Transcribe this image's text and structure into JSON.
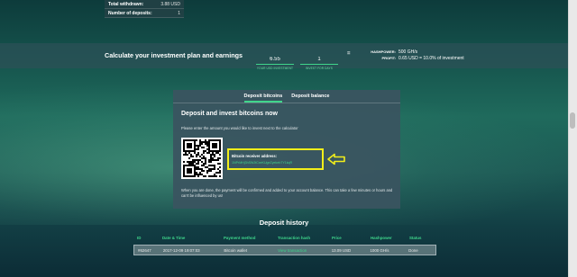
{
  "colors": {
    "accent": "#3ed58b",
    "highlight_border": "#f2ee1a",
    "panel": "#3a5460"
  },
  "stats": [
    {
      "label": "Total withdrawn:",
      "value": "3.88 USD"
    },
    {
      "label": "Number of deposits:",
      "value": "1"
    }
  ],
  "calculator": {
    "title": "Calculate your investment plan and earnings",
    "investment": {
      "value": "6.55",
      "caption": "YOUR USD INVESTMENT"
    },
    "days": {
      "value": "1",
      "caption": "INVEST FOR DAYS"
    },
    "equals": "=",
    "hashpower": {
      "label": "HASHPOWER:",
      "value": "500 GH/s"
    },
    "profit": {
      "label": "PROFIT:",
      "value": "0.65 USD = 10.0% of investment"
    }
  },
  "deposit_card": {
    "tabs": [
      "Deposit bitcoins",
      "Deposit balance"
    ],
    "active_tab": "Deposit bitcoins",
    "title": "Deposit and invest bitcoins now",
    "instruction": "Please enter the amount you would like to invest next to the calculator",
    "receiver_label": "Bitcoin receiver address:",
    "receiver_address": "1NPrMHj3hSWJtCxeKUgeZyekeb7Y1kqR",
    "notice": "When you are done, the payment will be confirmed and added to your account balance. This can take a few minutes or hours and can't be influenced by us!",
    "arrow_icon": "arrow-left-icon"
  },
  "history": {
    "title": "Deposit history",
    "columns": [
      "ID",
      "Date & Time",
      "Payment method",
      "Transaction hash",
      "Price",
      "Hashpower",
      "Status"
    ],
    "rows": [
      {
        "id": "#62647",
        "datetime": "2017-12-09 19:07:03",
        "method": "Bitcoin wallet",
        "hash": "View transaction",
        "price": "13.09 USD",
        "hashpower": "1000 GH/s",
        "status": "Done"
      }
    ]
  }
}
